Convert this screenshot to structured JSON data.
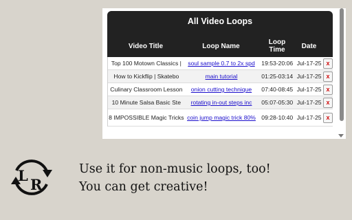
{
  "popup": {
    "title": "All Video Loops",
    "columns": {
      "video_title": "Video Title",
      "loop_name": "Loop Name",
      "loop_time_line1": "Loop",
      "loop_time_line2": "Time",
      "date": "Date"
    },
    "rows": [
      {
        "video_title": "Top 100 Motown Classics |",
        "loop_name": "soul sample 0.7 to 2x spd",
        "loop_time": "19:53-20:06",
        "date": "Jul-17-25",
        "delete_label": "x"
      },
      {
        "video_title": "How to Kickflip | Skatebo",
        "loop_name": "main tutorial",
        "loop_time": "01:25-03:14",
        "date": "Jul-17-25",
        "delete_label": "x"
      },
      {
        "video_title": "Culinary Classroom Lesson",
        "loop_name": "onion cutting technique",
        "loop_time": "07:40-08:45",
        "date": "Jul-17-25",
        "delete_label": "x"
      },
      {
        "video_title": "10 Minute Salsa Basic Ste",
        "loop_name": "rotating in-out steps inc",
        "loop_time": "05:07-05:30",
        "date": "Jul-17-25",
        "delete_label": "x"
      },
      {
        "video_title": "8 IMPOSSIBLE Magic Tricks",
        "loop_name": "coin jump magic trick 80%",
        "loop_time": "09:28-10:40",
        "date": "Jul-17-25",
        "delete_label": "x"
      }
    ]
  },
  "logo": {
    "left_letter": "L",
    "right_letter": "R",
    "icon": "loop-arrows-icon"
  },
  "tagline": {
    "line1": "Use it for non-music loops, too!",
    "line2": "You can get creative!"
  },
  "colors": {
    "header_bg": "#222222",
    "link": "#1a0dcc",
    "delete_x": "#d01010",
    "page_bg": "#d8d4cc"
  }
}
